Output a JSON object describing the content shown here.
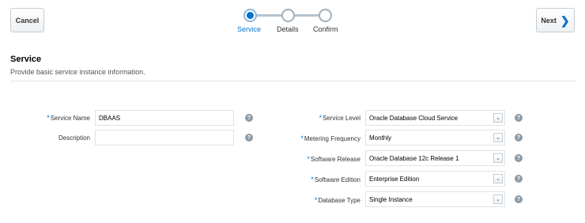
{
  "toolbar": {
    "cancel_label": "Cancel",
    "next_label": "Next",
    "next_icon": "chevron-right-icon"
  },
  "train": {
    "steps": [
      {
        "label": "Service",
        "active": true
      },
      {
        "label": "Details",
        "active": false
      },
      {
        "label": "Confirm",
        "active": false
      }
    ]
  },
  "section": {
    "title": "Service",
    "subtitle": "Provide basic service instance information."
  },
  "form": {
    "required_mark": "*",
    "help_glyph": "?",
    "service_name": {
      "label": "Service Name",
      "value": "DBAAS",
      "required": true
    },
    "description": {
      "label": "Description",
      "value": "",
      "required": false
    },
    "service_level": {
      "label": "Service Level",
      "value": "Oracle Database Cloud Service",
      "required": true
    },
    "metering_frequency": {
      "label": "Metering Frequency",
      "value": "Monthly",
      "required": true
    },
    "software_release": {
      "label": "Software Release",
      "value": "Oracle Database 12c Release 1",
      "required": true
    },
    "software_edition": {
      "label": "Software Edition",
      "value": "Enterprise Edition",
      "required": true
    },
    "database_type": {
      "label": "Database Type",
      "value": "Single Instance",
      "required": true
    }
  },
  "colors": {
    "accent": "#0572ce",
    "border": "#dfe4e8",
    "help": "#8d9aa4"
  }
}
